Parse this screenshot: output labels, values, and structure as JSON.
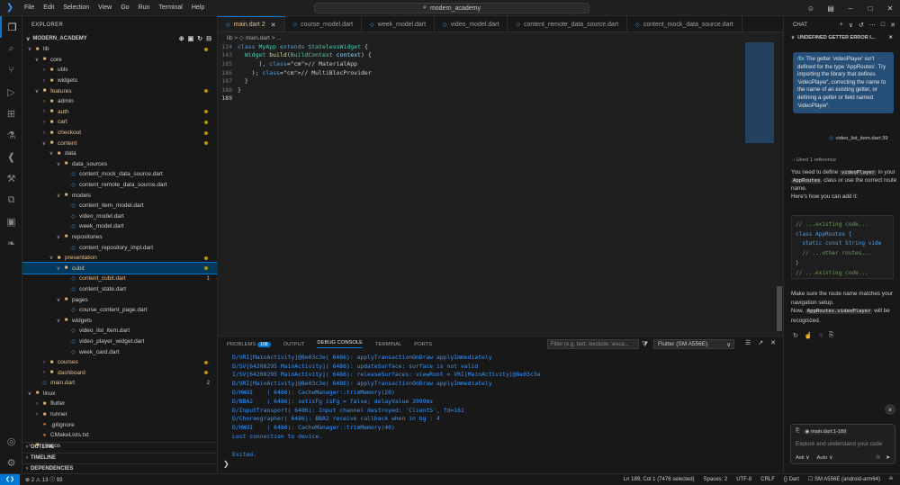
{
  "menu": [
    "File",
    "Edit",
    "Selection",
    "View",
    "Go",
    "Run",
    "Terminal",
    "Help"
  ],
  "search": {
    "text": "modern_academy"
  },
  "explorer": {
    "header": "EXPLORER",
    "project": "MODERN_ACADEMY",
    "tree": [
      {
        "label": "lib",
        "depth": 0,
        "type": "folder",
        "open": true,
        "dot": true
      },
      {
        "label": "core",
        "depth": 1,
        "type": "folder",
        "open": true
      },
      {
        "label": "utils",
        "depth": 2,
        "type": "folder",
        "open": false
      },
      {
        "label": "widgets",
        "depth": 2,
        "type": "folder",
        "open": false
      },
      {
        "label": "features",
        "depth": 1,
        "type": "folder",
        "open": true,
        "mod": true,
        "dot": true
      },
      {
        "label": "admin",
        "depth": 2,
        "type": "folder",
        "open": false
      },
      {
        "label": "auth",
        "depth": 2,
        "type": "folder",
        "open": false,
        "mod": true,
        "dot": true
      },
      {
        "label": "cart",
        "depth": 2,
        "type": "folder",
        "open": false,
        "mod": true,
        "dot": true
      },
      {
        "label": "checkout",
        "depth": 2,
        "type": "folder",
        "open": false,
        "mod": true,
        "dot": true
      },
      {
        "label": "content",
        "depth": 2,
        "type": "folder",
        "open": true,
        "mod": true,
        "dot": true
      },
      {
        "label": "data",
        "depth": 3,
        "type": "folder",
        "open": true
      },
      {
        "label": "data_sources",
        "depth": 4,
        "type": "folder",
        "open": true
      },
      {
        "label": "content_mock_data_source.dart",
        "depth": 5,
        "type": "dart"
      },
      {
        "label": "content_remote_data_source.dart",
        "depth": 5,
        "type": "dart"
      },
      {
        "label": "models",
        "depth": 4,
        "type": "folder",
        "open": true
      },
      {
        "label": "content_item_model.dart",
        "depth": 5,
        "type": "dart"
      },
      {
        "label": "video_model.dart",
        "depth": 5,
        "type": "dart"
      },
      {
        "label": "week_model.dart",
        "depth": 5,
        "type": "dart"
      },
      {
        "label": "repositories",
        "depth": 4,
        "type": "folder",
        "open": true
      },
      {
        "label": "content_repository_impl.dart",
        "depth": 5,
        "type": "dart"
      },
      {
        "label": "presentation",
        "depth": 3,
        "type": "folder",
        "open": true,
        "mod": true,
        "dot": true
      },
      {
        "label": "cubit",
        "depth": 4,
        "type": "folder",
        "open": true,
        "mod": true,
        "dot": true,
        "selected": true
      },
      {
        "label": "content_cubit.dart",
        "depth": 5,
        "type": "dart",
        "mod": true,
        "num": "1"
      },
      {
        "label": "content_state.dart",
        "depth": 5,
        "type": "dart"
      },
      {
        "label": "pages",
        "depth": 4,
        "type": "folder",
        "open": true
      },
      {
        "label": "course_content_page.dart",
        "depth": 5,
        "type": "dart"
      },
      {
        "label": "widgets",
        "depth": 4,
        "type": "folder",
        "open": true
      },
      {
        "label": "video_list_item.dart",
        "depth": 5,
        "type": "dart"
      },
      {
        "label": "video_player_widget.dart",
        "depth": 5,
        "type": "dart"
      },
      {
        "label": "week_card.dart",
        "depth": 5,
        "type": "dart"
      },
      {
        "label": "courses",
        "depth": 2,
        "type": "folder",
        "open": false,
        "mod": true,
        "dot": true
      },
      {
        "label": "dashboard",
        "depth": 2,
        "type": "folder",
        "open": false,
        "mod": true,
        "dot": true
      },
      {
        "label": "main.dart",
        "depth": 1,
        "type": "dart",
        "mod": true,
        "num": "2"
      },
      {
        "label": "linux",
        "depth": 0,
        "type": "folder",
        "open": true
      },
      {
        "label": "flutter",
        "depth": 1,
        "type": "folder",
        "open": false
      },
      {
        "label": "runner",
        "depth": 1,
        "type": "folder",
        "open": false
      },
      {
        "label": ".gitignore",
        "depth": 1,
        "type": "other"
      },
      {
        "label": "CMakeLists.txt",
        "depth": 1,
        "type": "other"
      },
      {
        "label": "macos",
        "depth": 0,
        "type": "folder",
        "open": false
      }
    ],
    "outline": "OUTLINE",
    "timeline": "TIMELINE",
    "dependencies": "DEPENDENCIES"
  },
  "tabs": [
    {
      "label": "main.dart 2",
      "active": true
    },
    {
      "label": "course_model.dart"
    },
    {
      "label": "week_model.dart"
    },
    {
      "label": "video_model.dart"
    },
    {
      "label": "content_remote_data_source.dart"
    },
    {
      "label": "content_mock_data_source.dart"
    }
  ],
  "breadcrumb": "lib > ◇ main.dart > ...",
  "code": [
    {
      "ln": "124",
      "text": "class MyApp extends StatelessWidget {"
    },
    {
      "ln": "143",
      "text": "  Widget build(BuildContext context) {"
    },
    {
      "ln": "185",
      "text": "      ), // MaterialApp"
    },
    {
      "ln": "186",
      "text": "    ); // MultiBlocProvider"
    },
    {
      "ln": "187",
      "text": "  }"
    },
    {
      "ln": "188",
      "text": "}"
    },
    {
      "ln": "189",
      "text": ""
    }
  ],
  "panel": {
    "tabs": [
      "PROBLEMS",
      "OUTPUT",
      "DEBUG CONSOLE",
      "TERMINAL",
      "PORTS"
    ],
    "problems_count": "108",
    "filter_placeholder": "Filter (e.g. text, !exclude, \\esca...",
    "device": "Flutter (SM A556E)",
    "log": [
      "D/VRI[MainActivity]@8e03c3e( 6486): applyTransactionOnDraw applyImmediately",
      "D/SV[64208295 MainActivity]( 6486): updateSurface: surface is not valid",
      "I/SV[64208295 MainActivity]( 6486): releaseSurfaces: viewRoot = VRI[MainActivity]@8e03c3e",
      "D/VRI[MainActivity]@8e03c3e( 6486): applyTransactionOnDraw applyImmediately",
      "D/HWUI    ( 6486): CacheManager::trimMemory(20)",
      "D/BBA2    ( 6486): setisFg isFg = false; delayValue 3999ms",
      "D/InputTransport( 6486): Input channel destroyed: 'ClientS', fd=161",
      "D/Choreographer( 6486): BBA2 receive callback when in bg : 4",
      "D/HWUI    ( 6486): CacheManager::trimMemory(40)",
      "Lost connection to device.",
      "",
      "Exited."
    ]
  },
  "chat": {
    "header": "CHAT",
    "conversation_title": "UNDEFINED GETTER ERROR I...",
    "user_prefix": "/fix",
    "user_message": "The getter 'videoPlayer' isn't defined for the type 'AppRoutes'. Try importing the library that defines 'videoPlayer', correcting the name to the name of an existing getter, or defining a getter or field named 'videoPlayer'.",
    "reference": "video_list_item.dart:39",
    "used": "Used 1 reference",
    "resp_a": "You need to define",
    "resp_code1": "videoPlayer",
    "resp_b": "in your",
    "resp_code2": "AppRoutes",
    "resp_c": "class or use the correct route name.",
    "resp_d": "Here's how you can add it:",
    "codeblock": [
      "// ...existing code...",
      "class AppRoutes {",
      "  static const String vide",
      "  // ...other routes...",
      "}",
      "// ...existing code..."
    ],
    "resp2_a": "Make sure the route name matches your navigation setup.",
    "resp2_b": "Now,",
    "resp2_code": "AppRoutes.videoPlayer",
    "resp2_c": "will be recognized.",
    "input_context": "main.dart:1-189",
    "input_placeholder": "Explore and understand your code",
    "mode": "Ask",
    "model": "Auto"
  },
  "status": {
    "problems": "⊗ 2 ⚠ 13 ⓘ 93",
    "items": [
      "Ln 189, Col 1 (7476 selected)",
      "Spaces: 2",
      "UTF-8",
      "CRLF",
      "{} Dart",
      "☐ SM A556E (android-arm64)"
    ]
  }
}
